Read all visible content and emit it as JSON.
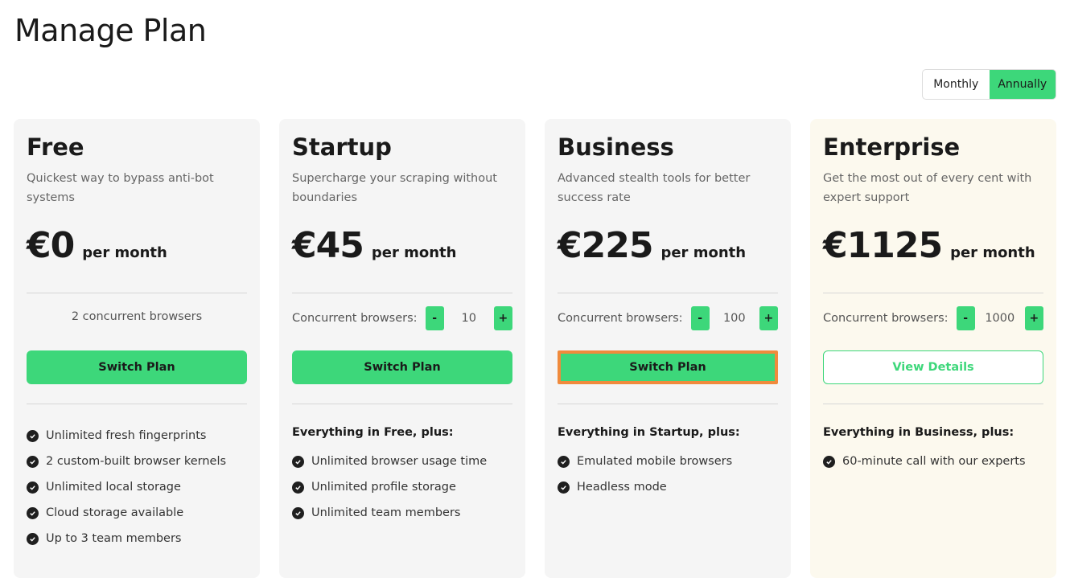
{
  "page_title": "Manage Plan",
  "billing_toggle": {
    "monthly": "Monthly",
    "annually": "Annually",
    "selected": "Annually"
  },
  "colors": {
    "accent": "#3dd77a",
    "highlight": "#f08a3c",
    "card_bg": "#f5f5f5",
    "enterprise_bg": "#fcf9ee"
  },
  "plans": [
    {
      "name": "Free",
      "description": "Quickest way to bypass anti-bot systems",
      "price": "€0",
      "per": "per month",
      "browsers_text": "2 concurrent browsers",
      "button_label": "Switch Plan",
      "features": [
        "Unlimited fresh fingerprints",
        "2 custom-built browser kernels",
        "Unlimited local storage",
        "Cloud storage available",
        "Up to 3 team members"
      ]
    },
    {
      "name": "Startup",
      "description": "Supercharge your scraping without boundaries",
      "price": "€45",
      "per": "per month",
      "browsers_label": "Concurrent browsers:",
      "browsers_value": "10",
      "minus": "-",
      "plus": "+",
      "button_label": "Switch Plan",
      "features_heading": "Everything in Free, plus:",
      "features": [
        "Unlimited browser usage time",
        "Unlimited profile storage",
        "Unlimited team members"
      ]
    },
    {
      "name": "Business",
      "description": "Advanced stealth tools for better success rate",
      "price": "€225",
      "per": "per month",
      "browsers_label": "Concurrent browsers:",
      "browsers_value": "100",
      "minus": "-",
      "plus": "+",
      "button_label": "Switch Plan",
      "features_heading": "Everything in Startup, plus:",
      "features": [
        "Emulated mobile browsers",
        "Headless mode"
      ]
    },
    {
      "name": "Enterprise",
      "description": "Get the most out of every cent with expert support",
      "price": "€1125",
      "per": "per month",
      "browsers_label": "Concurrent browsers:",
      "browsers_value": "1000",
      "minus": "-",
      "plus": "+",
      "button_label": "View Details",
      "features_heading": "Everything in Business, plus:",
      "features": [
        "60-minute call with our experts"
      ]
    }
  ]
}
